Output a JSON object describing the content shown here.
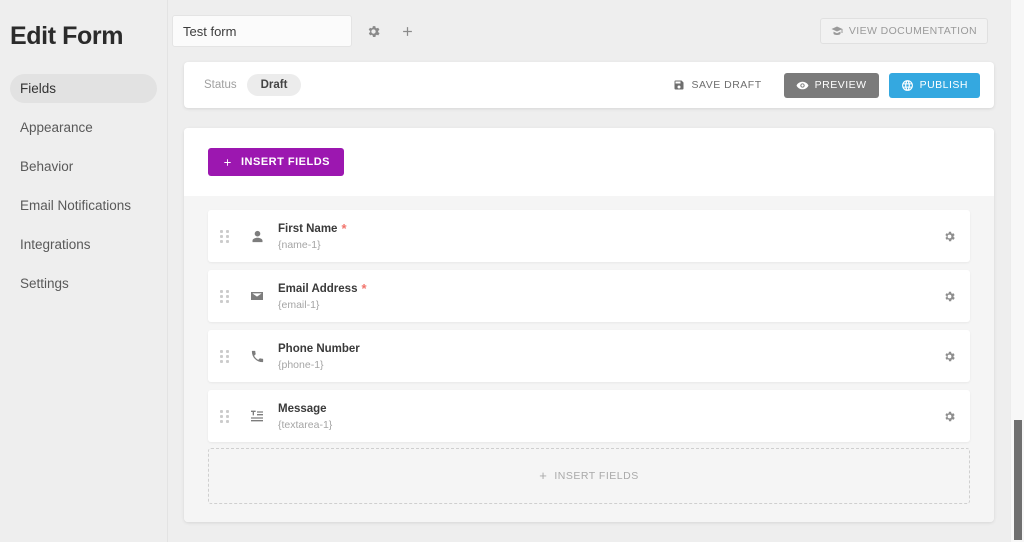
{
  "sidebar": {
    "brand": "Edit Form",
    "items": [
      {
        "label": "Fields",
        "active": true
      },
      {
        "label": "Appearance",
        "active": false
      },
      {
        "label": "Behavior",
        "active": false
      },
      {
        "label": "Email Notifications",
        "active": false
      },
      {
        "label": "Integrations",
        "active": false
      },
      {
        "label": "Settings",
        "active": false
      }
    ]
  },
  "topbar": {
    "form_title_value": "Test form",
    "form_title_placeholder": "Form title",
    "settings_icon": "gear-icon",
    "add_icon": "plus-icon",
    "doc_button_label": "VIEW DOCUMENTATION",
    "doc_button_icon": "graduation-cap-icon"
  },
  "statusbar": {
    "status_label": "Status",
    "status_value": "Draft",
    "save_draft_label": "SAVE DRAFT",
    "save_draft_icon": "floppy-disk-icon",
    "preview_label": "PREVIEW",
    "preview_icon": "eye-icon",
    "publish_label": "PUBLISH",
    "publish_icon": "globe-icon"
  },
  "builder": {
    "insert_fields_label": "INSERT FIELDS",
    "insert_fields_icon": "plus-icon",
    "dropzone_label": "INSERT FIELDS",
    "dropzone_icon": "plus-icon",
    "fields": [
      {
        "label": "First Name",
        "tag": "{name-1}",
        "required": true,
        "icon": "user-icon",
        "settings_icon": "gear-icon"
      },
      {
        "label": "Email Address",
        "tag": "{email-1}",
        "required": true,
        "icon": "envelope-icon",
        "settings_icon": "gear-icon"
      },
      {
        "label": "Phone Number",
        "tag": "{phone-1}",
        "required": false,
        "icon": "phone-icon",
        "settings_icon": "gear-icon"
      },
      {
        "label": "Message",
        "tag": "{textarea-1}",
        "required": false,
        "icon": "text-lines-icon",
        "settings_icon": "gear-icon"
      }
    ]
  },
  "colors": {
    "accent_purple": "#9c17b0",
    "publish_blue": "#34a8e0",
    "preview_gray": "#7b7b7b",
    "required_red": "#f2736b",
    "page_bg": "#eeeeee",
    "card_bg": "#ffffff",
    "fields_bg": "#f5f5f5"
  }
}
